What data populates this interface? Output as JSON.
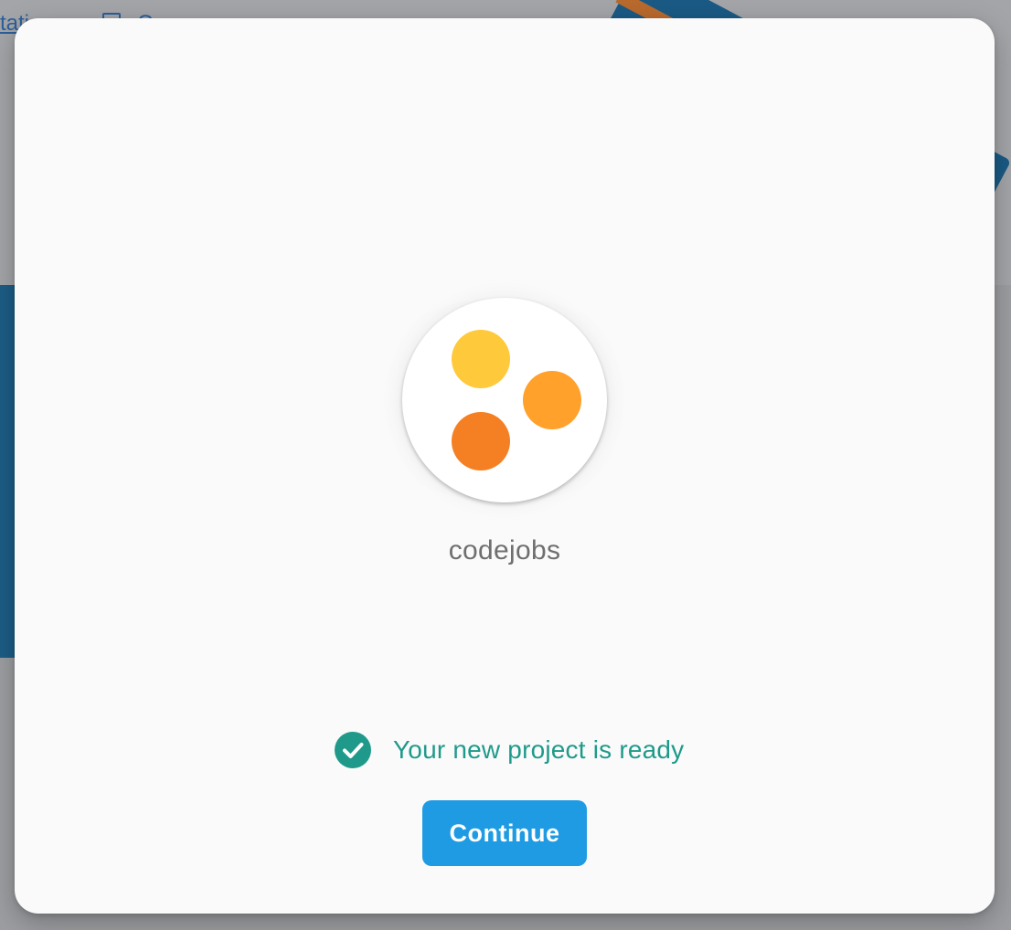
{
  "background": {
    "link_text": "tati",
    "second_link_text": "C"
  },
  "project": {
    "name": "codejobs",
    "avatar_colors": [
      "#ffc93c",
      "#ffa12b",
      "#f58023"
    ]
  },
  "status": {
    "text": "Your new project is ready",
    "icon": "check-circle-icon",
    "color": "#1f9a8a"
  },
  "actions": {
    "continue_label": "Continue",
    "continue_color": "#1e9be3"
  }
}
